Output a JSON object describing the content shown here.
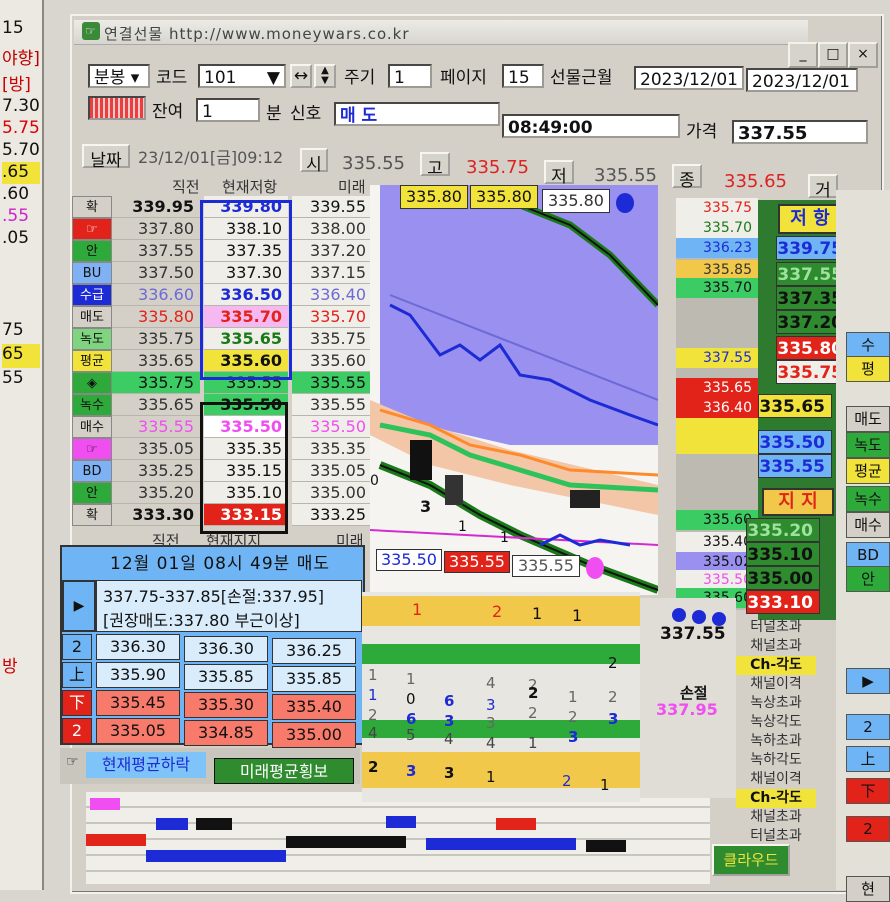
{
  "left_strip": {
    "items": [
      "15",
      "야향]",
      "[방]",
      "7.30",
      "5.75",
      "5.70",
      ".65",
      ".60",
      ".55",
      ".05",
      "75",
      "65",
      "55",
      "방"
    ]
  },
  "title": "연결선물  http://www.moneywars.co.kr",
  "window_controls": [
    "_",
    "□",
    "×"
  ],
  "toolbar": {
    "type_value": "분봉",
    "code_label": "코드",
    "code_value": "101",
    "period_label": "주기",
    "period_value": "1",
    "page_label": "페이지",
    "page_value": "15",
    "month_label": "선물근월",
    "date_from": "2023/12/01",
    "date_to": "2023/12/01",
    "balance_label": "잔여",
    "balance_value": "1",
    "minute_label": "분",
    "signal_label": "신호",
    "signal_value": "매 도",
    "time_value": "08:49:00",
    "price_label": "가격",
    "price_value": "337.55"
  },
  "info_bar": {
    "date_button": "날짜",
    "datetime": "23/12/01[금]09:12",
    "open_label": "시",
    "open": "335.55",
    "high_label": "고",
    "high": "335.75",
    "low_label": "저",
    "low": "335.55",
    "close_label": "종",
    "close": "335.65",
    "go_label": "거"
  },
  "table": {
    "headers": [
      "직전",
      "현재저항",
      "미래"
    ],
    "footer_headers": [
      "직전",
      "현재지지",
      "미래"
    ],
    "side_labels": [
      "확",
      "☞",
      "안",
      "BU",
      "수급",
      "매도",
      "녹도",
      "평균",
      "◈",
      "녹수",
      "매수",
      "☞",
      "BD",
      "안",
      "확"
    ],
    "rows": [
      {
        "prev": "339.95",
        "cur": "339.80",
        "fut": "339.55"
      },
      {
        "prev": "337.80",
        "cur": "338.10",
        "fut": "338.00"
      },
      {
        "prev": "337.55",
        "cur": "337.35",
        "fut": "337.20"
      },
      {
        "prev": "337.50",
        "cur": "337.30",
        "fut": "337.15"
      },
      {
        "prev": "336.60",
        "cur": "336.50",
        "fut": "336.40"
      },
      {
        "prev": "335.80",
        "cur": "335.70",
        "fut": "335.70"
      },
      {
        "prev": "335.75",
        "cur": "335.65",
        "fut": "335.75"
      },
      {
        "prev": "335.65",
        "cur": "335.60",
        "fut": "335.60"
      },
      {
        "prev": "335.75",
        "cur": "335.55",
        "fut": "335.55"
      },
      {
        "prev": "335.65",
        "cur": "335.50",
        "fut": "335.55"
      },
      {
        "prev": "335.55",
        "cur": "335.50",
        "fut": "335.50"
      },
      {
        "prev": "335.05",
        "cur": "335.35",
        "fut": "335.35"
      },
      {
        "prev": "335.25",
        "cur": "335.15",
        "fut": "335.05"
      },
      {
        "prev": "335.20",
        "cur": "335.10",
        "fut": "335.00"
      },
      {
        "prev": "333.30",
        "cur": "333.15",
        "fut": "333.25"
      }
    ]
  },
  "chart": {
    "top_boxes": [
      "335.80",
      "335.80",
      "335.80"
    ],
    "bottom_boxes": [
      "335.50",
      "335.55",
      "335.55"
    ],
    "numbers": [
      "0",
      "3",
      "1",
      "1"
    ]
  },
  "price_ladder": [
    "335.75",
    "335.70",
    "336.23",
    "335.85",
    "335.70",
    "337.55",
    "335.65",
    "336.40",
    "335.60",
    "335.40",
    "335.02",
    "335.50",
    "335.60"
  ],
  "resistance": {
    "label": "저 항",
    "values": [
      "339.75",
      "337.55",
      "337.35",
      "337.20",
      "335.80",
      "335.75",
      "335.65",
      "335.50",
      "335.55"
    ]
  },
  "support": {
    "label": "지 지",
    "values": [
      "335.20",
      "335.10",
      "335.00",
      "333.10"
    ]
  },
  "order_panel": {
    "title": "12월 01일  08시 49분 매도",
    "line1": "337.75-337.85[손절:337.95]",
    "line2": "[권장매도:337.80 부근이상]",
    "rows": [
      {
        "tag": "2",
        "a": "336.30",
        "b": "336.30",
        "c": "336.25"
      },
      {
        "tag": "上",
        "a": "335.90",
        "b": "335.85",
        "c": "335.85"
      },
      {
        "tag": "下",
        "a": "335.45",
        "b": "335.30",
        "c": "335.40"
      },
      {
        "tag": "2",
        "a": "335.05",
        "b": "334.85",
        "c": "335.00"
      }
    ],
    "status_left": "현재평균하락",
    "status_right": "미래평균횡보"
  },
  "grid": {
    "row1": [
      "1",
      "2",
      "1",
      "1"
    ],
    "row_nums_a": [
      "1",
      "1",
      "4",
      "2",
      "2"
    ],
    "row_nums_b": [
      "1",
      "0",
      "6",
      "3",
      "2",
      "1",
      "2"
    ],
    "row_nums_c": [
      "2",
      "6",
      "3",
      "3",
      "2",
      "2",
      "3"
    ],
    "row_nums_d": [
      "4",
      "5",
      "4",
      "4",
      "1",
      "3"
    ],
    "row_last": [
      "2",
      "3",
      "3",
      "1",
      "2",
      "1"
    ]
  },
  "stop": {
    "value": "337.55",
    "label": "손절",
    "price": "337.95"
  },
  "signals": [
    "터널초과",
    "채널초과",
    "Ch-각도",
    "채널이격",
    "녹상초과",
    "녹상각도",
    "녹하초과",
    "녹하각도",
    "채널이격",
    "Ch-각도",
    "채널초과",
    "터널초과"
  ],
  "cloud_button": "클라우드",
  "right_strip": [
    "수",
    "평",
    "매도",
    "녹도",
    "평균",
    "녹수",
    "매수",
    "BD",
    "안",
    "▶",
    "2",
    "上",
    "下",
    "2",
    "현"
  ],
  "colors": {
    "accent_blue": "#1d2bd6",
    "resistance_yellow": "#f2e33a",
    "support_green": "#2e8b2e",
    "sell_red": "#e2231a",
    "panel_blue": "#6fb4f4",
    "chart_purple": "#9a90f0"
  }
}
